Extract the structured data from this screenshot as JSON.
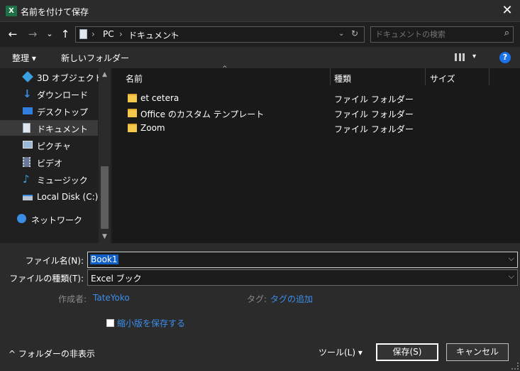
{
  "window": {
    "title": "名前を付けて保存",
    "app_icon_text": "X",
    "close_glyph": "✕"
  },
  "nav": {
    "back": "←",
    "forward": "→",
    "recent": "⌄",
    "up": "↑",
    "breadcrumbs": [
      "PC",
      "ドキュメント"
    ],
    "separator": "›",
    "search_placeholder": "ドキュメントの検索"
  },
  "toolbar": {
    "organize": "整理 ▾",
    "new_folder": "新しいフォルダー",
    "view_menu": "▾",
    "help": "?"
  },
  "sidebar": {
    "items": [
      {
        "label": "3D オブジェクト",
        "icon": "cube-icon",
        "color": "#3aa0e0"
      },
      {
        "label": "ダウンロード",
        "icon": "download-icon",
        "color": "#3a8ee6"
      },
      {
        "label": "デスクトップ",
        "icon": "desktop-icon",
        "color": "#2f7ee0"
      },
      {
        "label": "ドキュメント",
        "icon": "document-icon",
        "color": "#dfe6ee",
        "selected": true
      },
      {
        "label": "ピクチャ",
        "icon": "picture-icon",
        "color": "#9ab8d8"
      },
      {
        "label": "ビデオ",
        "icon": "video-icon",
        "color": "#6a7a9a"
      },
      {
        "label": "ミュージック",
        "icon": "music-icon",
        "color": "#3aa0e0"
      },
      {
        "label": "Local Disk (C:)",
        "icon": "drive-icon",
        "color": "#b8c4d0"
      },
      {
        "label": "ネットワーク",
        "icon": "network-icon",
        "color": "#3a8ee6"
      }
    ]
  },
  "columns": {
    "name": "名前",
    "type": "種類",
    "size": "サイズ",
    "sort_glyph": "^"
  },
  "files": [
    {
      "name": "et cetera",
      "type": "ファイル フォルダー"
    },
    {
      "name": "Office のカスタム テンプレート",
      "type": "ファイル フォルダー"
    },
    {
      "name": "Zoom",
      "type": "ファイル フォルダー"
    }
  ],
  "form": {
    "filename_label": "ファイル名(N):",
    "filename_value": "Book1",
    "filetype_label": "ファイルの種類(T):",
    "filetype_value": "Excel ブック",
    "author_label": "作成者:",
    "author_value": "TateYoko",
    "tags_label": "タグ:",
    "tags_value": "タグの追加",
    "thumbnail_label": "縮小版を保存する",
    "hide_folders": "^ フォルダーの非表示",
    "tools": "ツール(L)   ▾",
    "save": "保存(S)",
    "cancel": "キャンセル",
    "chevron": "⌵"
  }
}
